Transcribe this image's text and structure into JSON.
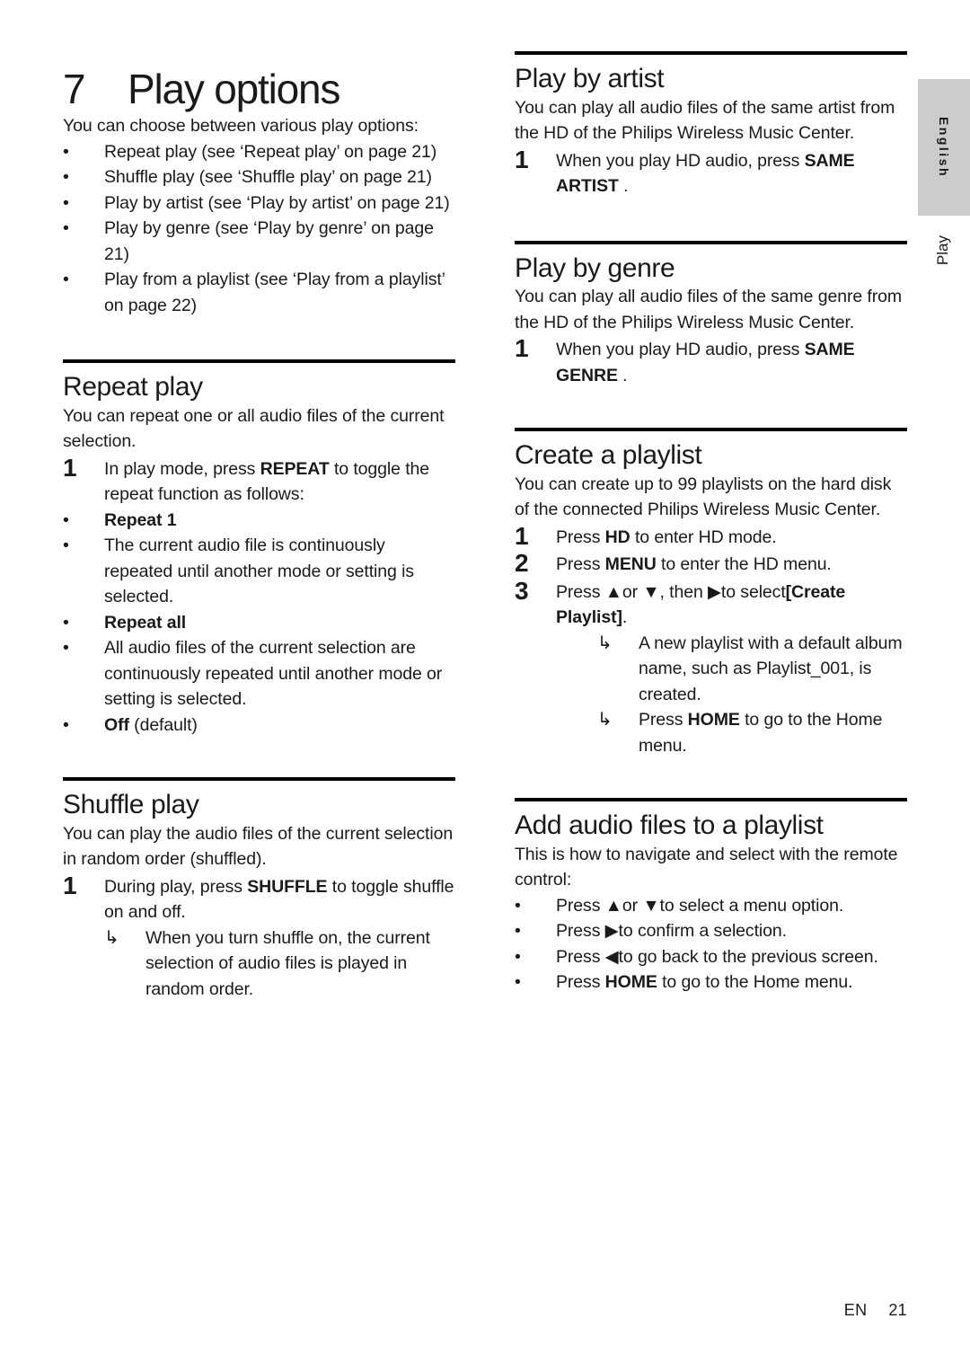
{
  "page": {
    "chapter_number": "7",
    "chapter_title": "Play options",
    "language_tab": "English",
    "chapter_tab": "Play",
    "footer_lang": "EN",
    "footer_page": "21",
    "accent_tab_color": "#cccccc",
    "rule_color": "#000000"
  },
  "intro": {
    "text": "You can choose between various play options:",
    "items": [
      "Repeat play (see ‘Repeat play’ on page 21)",
      "Shuffle play (see ‘Shuffle play’ on page 21)",
      "Play by artist (see ‘Play by artist’ on page 21)",
      "Play by genre (see ‘Play by genre’ on page 21)",
      "Play from a playlist (see ‘Play from a playlist’ on page 22)"
    ]
  },
  "repeat_play": {
    "heading": "Repeat play",
    "intro": "You can repeat one or all audio files of the current selection.",
    "step1_pre": "In play mode, press ",
    "step1_key": "REPEAT",
    "step1_post": " to toggle the repeat function as follows:",
    "options": [
      {
        "bold": "Repeat 1",
        "rest": ""
      },
      {
        "bold": "",
        "rest": "The current audio file is continuously repeated until another mode or setting is selected."
      },
      {
        "bold": "Repeat all",
        "rest": ""
      },
      {
        "bold": "",
        "rest": "All audio files of the current selection are continuously repeated until another mode or setting is selected."
      },
      {
        "bold": "Off",
        "rest": " (default)"
      }
    ]
  },
  "shuffle_play": {
    "heading": "Shuffle play",
    "intro": "You can play the audio files of the current selection in random order (shuffled).",
    "step1_pre": "During play, press ",
    "step1_key": "SHUFFLE",
    "step1_post": " to toggle shuffle on and off.",
    "result": "When you turn shuffle on, the current selection of audio files is played in random order."
  },
  "play_by_artist": {
    "heading": "Play by artist",
    "intro": "You can play all audio files of the same artist from the HD of the Philips Wireless Music Center.",
    "step1_pre": "When you play HD audio, press ",
    "step1_key": "SAME ARTIST",
    "step1_post": " ."
  },
  "play_by_genre": {
    "heading": "Play by genre",
    "intro": "You can play all audio files of the same genre from the HD of the Philips Wireless Music Center.",
    "step1_pre": "When you play HD audio, press ",
    "step1_key": "SAME GENRE",
    "step1_post": " ."
  },
  "create_playlist": {
    "heading": "Create a playlist",
    "intro": "You can create up to 99 playlists on the hard disk of the connected Philips Wireless Music Center.",
    "step1_pre": "Press ",
    "step1_key": "HD",
    "step1_post": " to enter HD mode.",
    "step2_pre": "Press ",
    "step2_key": "MENU",
    "step2_post": "  to enter the HD menu.",
    "step3_pre": "Press ▲or ▼, then ▶to select",
    "step3_key": "[Create Playlist]",
    "step3_post": ".",
    "result1": "A new playlist with a default album name, such as Playlist_001, is created.",
    "result2_pre": "Press ",
    "result2_key": "HOME",
    "result2_post": " to go to the Home menu."
  },
  "add_audio_files": {
    "heading": "Add audio files to a playlist",
    "intro": "This is how to navigate and select with the remote control:",
    "item1": "Press ▲or ▼to select a menu option.",
    "item2": "Press ▶to confirm a selection.",
    "item3": "Press ◀to go back to the previous screen.",
    "item4_pre": "Press ",
    "item4_key": "HOME",
    "item4_post": " to go to the Home menu."
  }
}
